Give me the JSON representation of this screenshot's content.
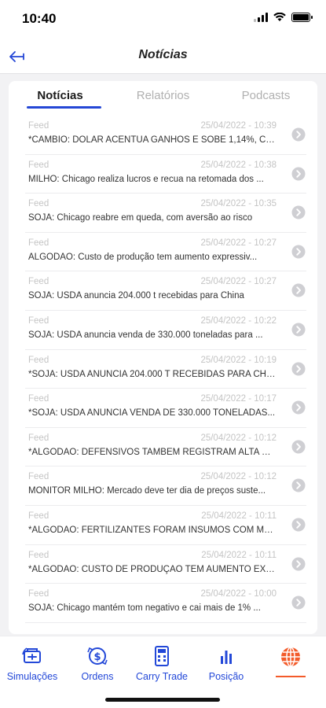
{
  "status_bar": {
    "time": "10:40"
  },
  "nav": {
    "title": "Notícias"
  },
  "tabs": [
    {
      "label": "Notícias",
      "active": true
    },
    {
      "label": "Relatórios",
      "active": false
    },
    {
      "label": "Podcasts",
      "active": false
    }
  ],
  "feed": [
    {
      "source": "Feed",
      "date": "25/04/2022 - 10:39",
      "headline": "*CÂMBIO: DÓLAR ACENTUA GANHOS E SOBE 1,14%, CO..."
    },
    {
      "source": "Feed",
      "date": "25/04/2022 - 10:38",
      "headline": "MILHO: Chicago realiza lucros e recua na retomada dos ..."
    },
    {
      "source": "Feed",
      "date": "25/04/2022 - 10:35",
      "headline": "SOJA: Chicago reabre em queda, com aversão ao risco"
    },
    {
      "source": "Feed",
      "date": "25/04/2022 - 10:27",
      "headline": "ALGODÃO: Custo de produção tem aumento expressiv..."
    },
    {
      "source": "Feed",
      "date": "25/04/2022 - 10:27",
      "headline": "SOJA: USDA anuncia 204.000 t recebidas para China"
    },
    {
      "source": "Feed",
      "date": "25/04/2022 - 10:22",
      "headline": "SOJA: USDA anuncia venda de 330.000 toneladas para ..."
    },
    {
      "source": "Feed",
      "date": "25/04/2022 - 10:19",
      "headline": "*SOJA: USDA ANUNCIA 204.000 T RECEBIDAS PARA CHINA"
    },
    {
      "source": "Feed",
      "date": "25/04/2022 - 10:17",
      "headline": "*SOJA: USDA ANUNCIA VENDA DE 330.000 TONELADAS..."
    },
    {
      "source": "Feed",
      "date": "25/04/2022 - 10:12",
      "headline": "*ALGODÃO: DEFENSIVOS TAMBÉM REGISTRAM ALTA SI..."
    },
    {
      "source": "Feed",
      "date": "25/04/2022 - 10:12",
      "headline": "MONITOR MILHO: Mercado deve ter dia de preços suste..."
    },
    {
      "source": "Feed",
      "date": "25/04/2022 - 10:11",
      "headline": "*ALGODÃO: FERTILIZANTES FORAM INSUMOS COM MA..."
    },
    {
      "source": "Feed",
      "date": "25/04/2022 - 10:11",
      "headline": "*ALGODÃO: CUSTO DE PRODUÇÃO TEM AUMENTO EXP..."
    },
    {
      "source": "Feed",
      "date": "25/04/2022 - 10:00",
      "headline": "SOJA: Chicago mantém tom negativo e cai mais de 1% ..."
    }
  ],
  "bottom_nav": [
    {
      "label": "Simulações",
      "icon": "simulation-icon"
    },
    {
      "label": "Ordens",
      "icon": "orders-icon"
    },
    {
      "label": "Carry Trade",
      "icon": "calculator-icon"
    },
    {
      "label": "Posição",
      "icon": "position-chart-icon"
    },
    {
      "label": "",
      "icon": "globe-icon",
      "active": true
    }
  ],
  "colors": {
    "accent": "#2447d6",
    "active_tab": "#f35b2a",
    "muted": "#c4c4c4"
  }
}
